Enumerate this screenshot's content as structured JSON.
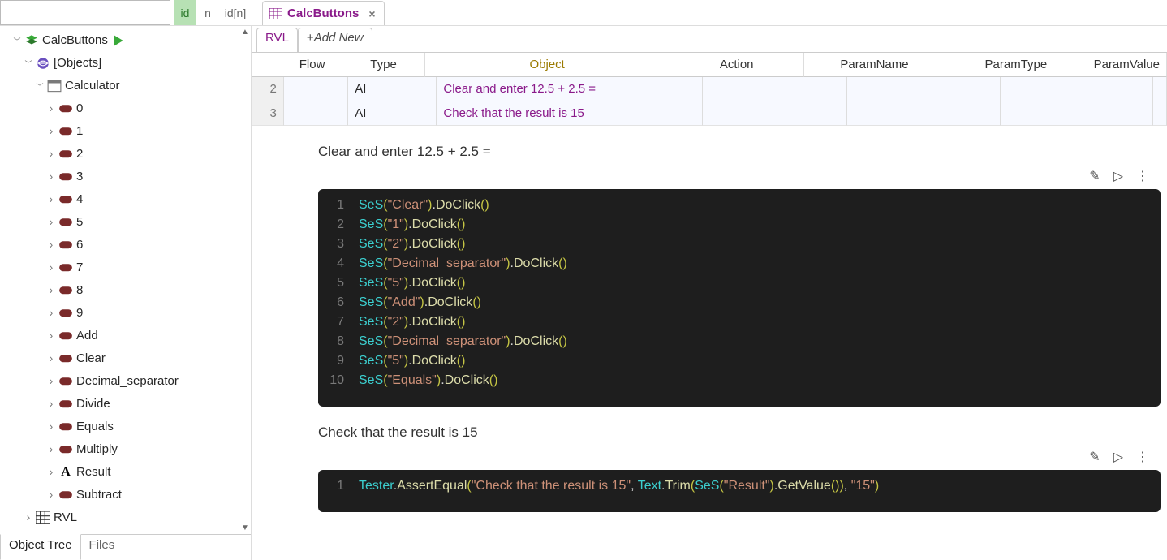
{
  "tabs": {
    "main": {
      "label": "CalcButtons"
    },
    "sub": {
      "rvl": "RVL",
      "addnew": "Add New"
    }
  },
  "topFilter": {
    "id": "id",
    "n": "n",
    "idn": "id[n]"
  },
  "bottomTabs": {
    "objectTree": "Object Tree",
    "files": "Files"
  },
  "tree": {
    "root": {
      "label": "CalcButtons"
    },
    "objects": {
      "label": "[Objects]"
    },
    "calculator": {
      "label": "Calculator"
    },
    "children": [
      {
        "label": "0"
      },
      {
        "label": "1"
      },
      {
        "label": "2"
      },
      {
        "label": "3"
      },
      {
        "label": "4"
      },
      {
        "label": "5"
      },
      {
        "label": "6"
      },
      {
        "label": "7"
      },
      {
        "label": "8"
      },
      {
        "label": "9"
      },
      {
        "label": "Add"
      },
      {
        "label": "Clear"
      },
      {
        "label": "Decimal_separator"
      },
      {
        "label": "Divide"
      },
      {
        "label": "Equals"
      },
      {
        "label": "Multiply"
      },
      {
        "label": "Result",
        "kind": "letter"
      },
      {
        "label": "Subtract"
      }
    ],
    "rvl": {
      "label": "RVL"
    }
  },
  "rvl": {
    "headers": {
      "flow": "Flow",
      "type": "Type",
      "object": "Object",
      "action": "Action",
      "pname": "ParamName",
      "ptype": "ParamType",
      "pval": "ParamValue"
    },
    "rows": [
      {
        "num": "2",
        "type": "AI",
        "object": "Clear and enter 12.5 + 2.5 ="
      },
      {
        "num": "3",
        "type": "AI",
        "object": "Check that the result is 15"
      }
    ]
  },
  "blocks": [
    {
      "caption": "Clear and enter 12.5 + 2.5 =",
      "lines": [
        {
          "kind": "doclick",
          "arg": "Clear"
        },
        {
          "kind": "doclick",
          "arg": "1"
        },
        {
          "kind": "doclick",
          "arg": "2"
        },
        {
          "kind": "doclick",
          "arg": "Decimal_separator"
        },
        {
          "kind": "doclick",
          "arg": "5"
        },
        {
          "kind": "doclick",
          "arg": "Add"
        },
        {
          "kind": "doclick",
          "arg": "2"
        },
        {
          "kind": "doclick",
          "arg": "Decimal_separator"
        },
        {
          "kind": "doclick",
          "arg": "5"
        },
        {
          "kind": "doclick",
          "arg": "Equals"
        }
      ]
    },
    {
      "caption": "Check that the result is 15",
      "lines": [
        {
          "kind": "assert",
          "msg": "Check that the result is 15",
          "obj": "Result",
          "expected": "15"
        }
      ]
    }
  ],
  "icons": {
    "wand": "✎",
    "play": "▷",
    "more": "⋮",
    "scrollUp": "▲",
    "scrollDown": "▼"
  }
}
